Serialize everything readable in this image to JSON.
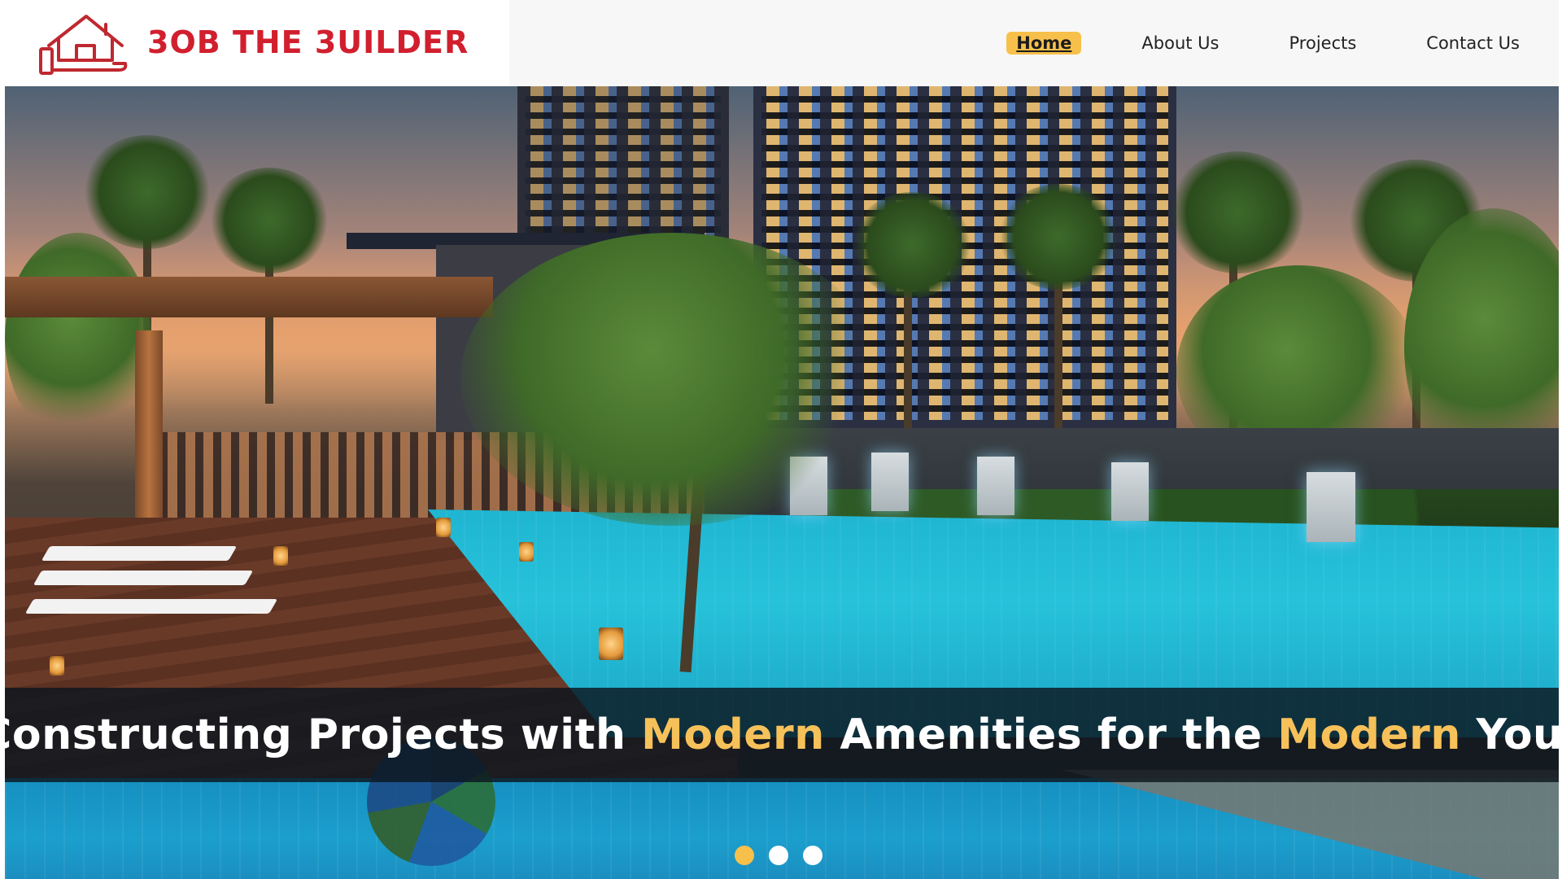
{
  "brand": {
    "name": "3OB THE 3UILDER",
    "color": "#d11f2e"
  },
  "nav": {
    "items": [
      {
        "label": "Home",
        "active": true
      },
      {
        "label": "About Us",
        "active": false
      },
      {
        "label": "Projects",
        "active": false
      },
      {
        "label": "Contact Us",
        "active": false
      }
    ],
    "active_color": "#f7c04b"
  },
  "hero": {
    "caption": {
      "part1": "Constructing Projects with ",
      "highlight1": "Modern",
      "part2": " Amenities for the ",
      "highlight2": "Modern",
      "part3": " You!"
    },
    "highlight_color": "#f7c15a",
    "slides": {
      "count": 3,
      "active_index": 0
    }
  },
  "icons": {
    "logo": "house-in-hand-icon"
  }
}
